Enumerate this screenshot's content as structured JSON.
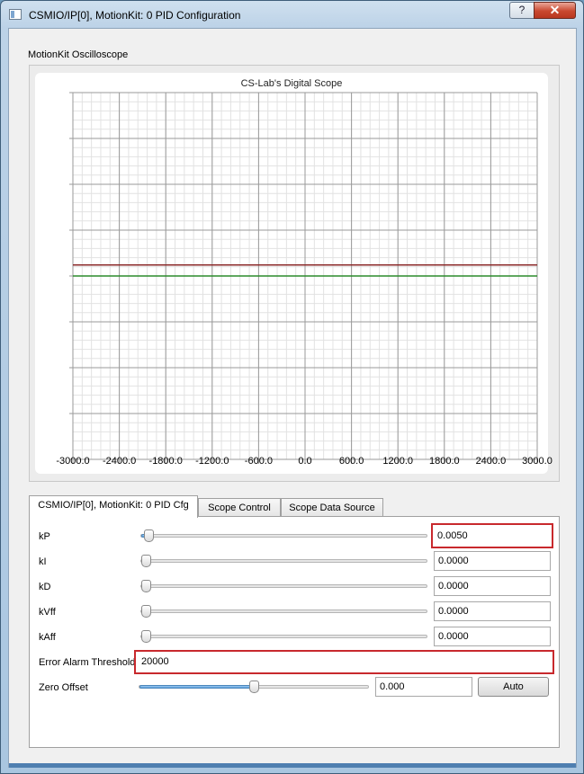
{
  "window": {
    "title": "CSMIO/IP[0], MotionKit: 0 PID Configuration",
    "help_label": "?",
    "close_label": "✕"
  },
  "group": {
    "label": "MotionKit Oscilloscope"
  },
  "chart_data": {
    "type": "line",
    "title": "CS-Lab's Digital Scope",
    "x_ticks": [
      "-3000.0",
      "-2400.0",
      "-1800.0",
      "-1200.0",
      "-600.0",
      "0.0",
      "600.0",
      "1200.0",
      "1800.0",
      "2400.0",
      "3000.0"
    ],
    "xlim": [
      -3000,
      3000
    ],
    "ylim": [
      -1,
      1
    ],
    "grid": true,
    "series": [
      {
        "color": "#8b2a2a",
        "x": [
          -3000,
          3000
        ],
        "y": [
          0.06,
          0.06
        ]
      },
      {
        "color": "#2b8b2b",
        "x": [
          -3000,
          3000
        ],
        "y": [
          0.0,
          0.0
        ]
      }
    ]
  },
  "tabs": [
    {
      "label": "CSMIO/IP[0], MotionKit: 0 PID Cfg",
      "active": true
    },
    {
      "label": "Scope Control",
      "active": false
    },
    {
      "label": "Scope Data Source",
      "active": false
    }
  ],
  "pid": {
    "kp": {
      "label": "kP",
      "value": "0.0050",
      "level": 0.01
    },
    "ki": {
      "label": "kI",
      "value": "0.0000",
      "level": 0
    },
    "kd": {
      "label": "kD",
      "value": "0.0000",
      "level": 0
    },
    "kvff": {
      "label": "kVff",
      "value": "0.0000",
      "level": 0
    },
    "kaff": {
      "label": "kAff",
      "value": "0.0000",
      "level": 0
    },
    "error_alarm": {
      "label": "Error Alarm Threshold",
      "value": "20000"
    },
    "zero_offset": {
      "label": "Zero Offset",
      "value": "0.000",
      "level": 0.5,
      "auto_label": "Auto"
    }
  },
  "colors": {
    "highlight": "#c8292d",
    "accent": "#4f7fb0"
  }
}
